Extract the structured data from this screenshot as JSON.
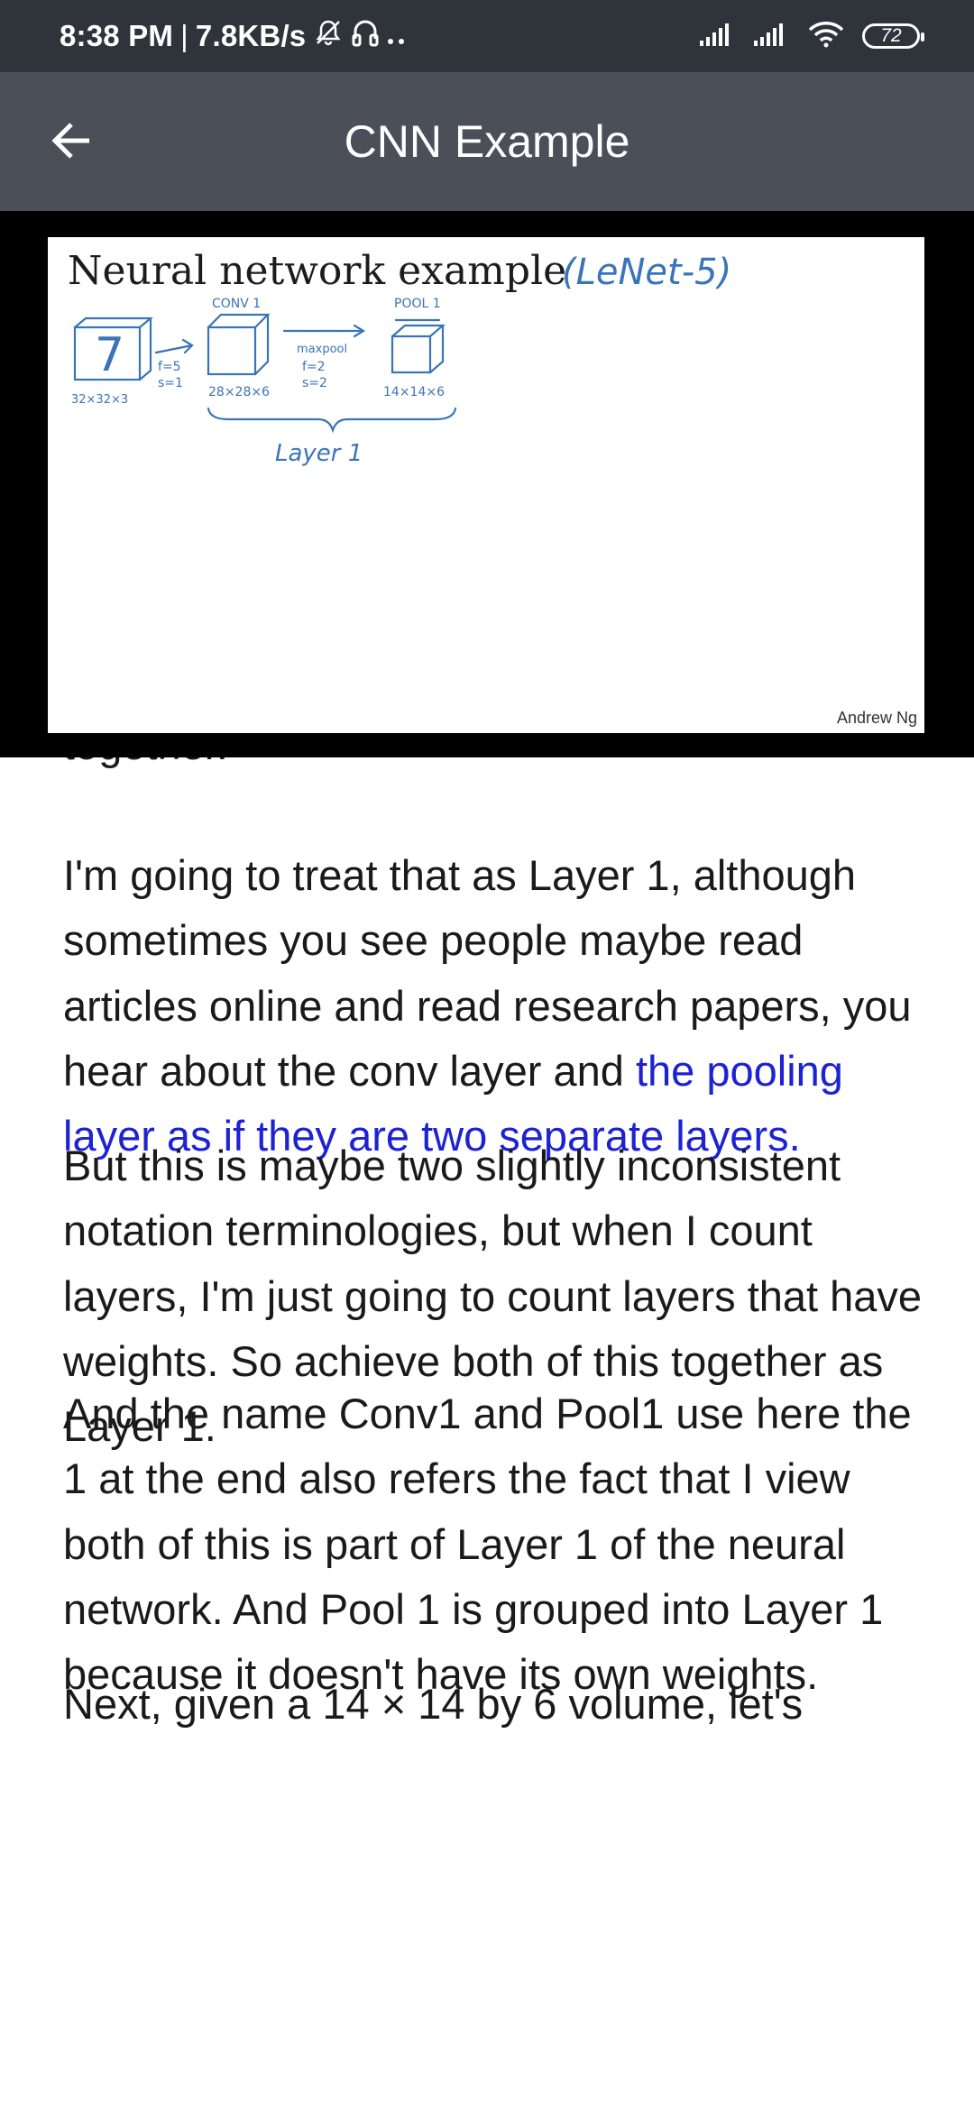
{
  "status_bar": {
    "time": "8:38 PM",
    "separator": "|",
    "net_speed": "7.8KB/s",
    "icons": [
      "mute-icon",
      "headphones-icon",
      "more-dots-icon",
      "signal-icon",
      "signal-icon",
      "wifi-icon",
      "battery-icon"
    ],
    "battery_level": "72"
  },
  "app_bar": {
    "title": "CNN Example",
    "back_icon": "arrow-left-icon"
  },
  "video": {
    "slide_title": "Neural network example",
    "handwritten_note": "(LeNet-5)",
    "credit": "Andrew Ng",
    "sketch_labels": {
      "conv1": "CONV 1",
      "pool1": "POOL 1",
      "input_dims": "32×32×3",
      "filter": "f=5",
      "stride": "s=1",
      "conv_dims": "28×28×6",
      "maxpool": "maxpool",
      "pool_f": "f=2",
      "pool_s": "s=2",
      "pool_dims": "14×14×6",
      "layer": "Layer 1",
      "digit": "7"
    }
  },
  "transcript": {
    "partial_top": "together.",
    "paragraphs": [
      {
        "text": "I'm going to treat that as Layer 1, although sometimes you see people maybe read articles online and read research papers, you hear about the conv layer and ",
        "highlight": "the pooling layer as if they are two separate layers."
      },
      {
        "text": "But this is maybe two slightly inconsistent notation terminologies, but when I count layers, I'm just going to count layers that have weights. So achieve both of this together as Layer 1."
      },
      {
        "text": "And the name Conv1 and Pool1 use here the 1 at the end also refers the fact that I view both of this is part of Layer 1 of the neural network. And Pool 1 is grouped into Layer 1 because it doesn't have its own weights."
      }
    ],
    "partial_bottom": "Next, given a 14 × 14 by 6 volume, let's"
  },
  "colors": {
    "status_bar_bg": "#2f333a",
    "app_bar_bg": "#4b4f58",
    "highlight_text": "#1d22d4",
    "ink_blue": "#3a74b8"
  }
}
